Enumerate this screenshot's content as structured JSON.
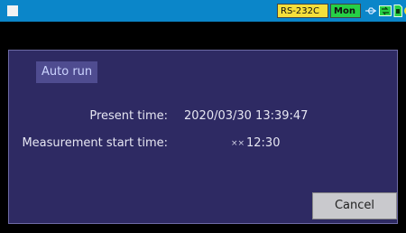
{
  "status_bar": {
    "rs232c_label": "RS-232C",
    "mon_label": "Mon",
    "icons": [
      "window-square-icon",
      "usb-icon",
      "lan-icon",
      "sd-card-icon",
      "power-icon"
    ],
    "colors": {
      "bar": "#0b86c9",
      "rs232c_bg": "#f5df3a",
      "mon_bg": "#26d046"
    }
  },
  "dialog": {
    "title": "Auto run",
    "present_time_label": "Present time:",
    "present_time_value": "2020/03/30 13:39:47",
    "start_time_label": "Measurement start time:",
    "start_time_date_placeholder": "××",
    "start_time_value": "12:30",
    "cancel_label": "Cancel",
    "colors": {
      "background": "#2e2a63",
      "title_bg": "#4f4c90"
    }
  }
}
